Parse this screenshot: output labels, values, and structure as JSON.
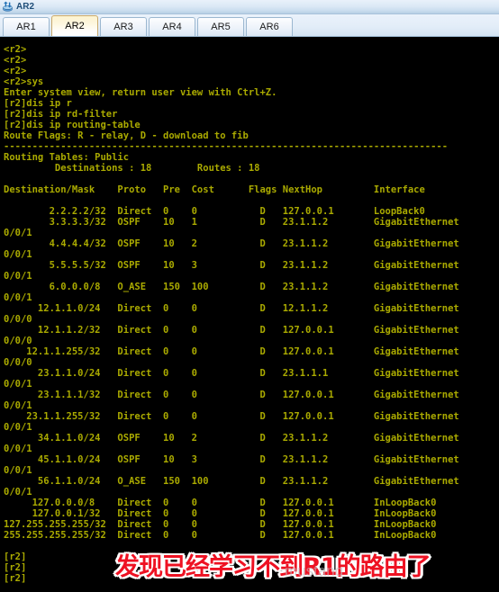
{
  "window": {
    "title": "AR2",
    "icon": "router-icon"
  },
  "tabs": [
    {
      "label": "AR1",
      "active": false
    },
    {
      "label": "AR2",
      "active": true
    },
    {
      "label": "AR3",
      "active": false
    },
    {
      "label": "AR4",
      "active": false
    },
    {
      "label": "AR5",
      "active": false
    },
    {
      "label": "AR6",
      "active": false
    }
  ],
  "terminal": {
    "prompt_user": "<r2>",
    "prompt_system": "[r2]",
    "foreground_color": "#aaaa00",
    "background_color": "#000000",
    "lines": [
      "<r2>",
      "<r2>",
      "<r2>",
      "<r2>sys",
      "Enter system view, return user view with Ctrl+Z.",
      "[r2]dis ip r",
      "[r2]dis ip rd-filter",
      "[r2]dis ip routing-table",
      "Route Flags: R - relay, D - download to fib",
      "------------------------------------------------------------------------------",
      "Routing Tables: Public",
      "         Destinations : 18        Routes : 18",
      "",
      "Destination/Mask    Proto   Pre  Cost      Flags NextHop         Interface",
      "",
      "        2.2.2.2/32  Direct  0    0           D   127.0.0.1       LoopBack0",
      "        3.3.3.3/32  OSPF    10   1           D   23.1.1.2        GigabitEthernet",
      "0/0/1",
      "        4.4.4.4/32  OSPF    10   2           D   23.1.1.2        GigabitEthernet",
      "0/0/1",
      "        5.5.5.5/32  OSPF    10   3           D   23.1.1.2        GigabitEthernet",
      "0/0/1",
      "        6.0.0.0/8   O_ASE   150  100         D   23.1.1.2        GigabitEthernet",
      "0/0/1",
      "      12.1.1.0/24   Direct  0    0           D   12.1.1.2        GigabitEthernet",
      "0/0/0",
      "      12.1.1.2/32   Direct  0    0           D   127.0.0.1       GigabitEthernet",
      "0/0/0",
      "    12.1.1.255/32   Direct  0    0           D   127.0.0.1       GigabitEthernet",
      "0/0/0",
      "      23.1.1.0/24   Direct  0    0           D   23.1.1.1        GigabitEthernet",
      "0/0/1",
      "      23.1.1.1/32   Direct  0    0           D   127.0.0.1       GigabitEthernet",
      "0/0/1",
      "    23.1.1.255/32   Direct  0    0           D   127.0.0.1       GigabitEthernet",
      "0/0/1",
      "      34.1.1.0/24   OSPF    10   2           D   23.1.1.2        GigabitEthernet",
      "0/0/1",
      "      45.1.1.0/24   OSPF    10   3           D   23.1.1.2        GigabitEthernet",
      "0/0/1",
      "      56.1.1.0/24   O_ASE   150  100         D   23.1.1.2        GigabitEthernet",
      "0/0/1",
      "     127.0.0.0/8    Direct  0    0           D   127.0.0.1       InLoopBack0",
      "     127.0.0.1/32   Direct  0    0           D   127.0.0.1       InLoopBack0",
      "127.255.255.255/32  Direct  0    0           D   127.0.0.1       InLoopBack0",
      "255.255.255.255/32  Direct  0    0           D   127.0.0.1       InLoopBack0",
      "",
      "[r2]",
      "[r2]",
      "[r2]"
    ],
    "routing_table": {
      "route_flags": "R - relay, D - download to fib",
      "table_name": "Public",
      "destinations": "18",
      "routes": "18",
      "columns": [
        "Destination/Mask",
        "Proto",
        "Pre",
        "Cost",
        "Flags",
        "NextHop",
        "Interface"
      ],
      "rows": [
        {
          "destination": "2.2.2.2/32",
          "proto": "Direct",
          "pre": "0",
          "cost": "0",
          "flags": "D",
          "nexthop": "127.0.0.1",
          "interface": "LoopBack0"
        },
        {
          "destination": "3.3.3.3/32",
          "proto": "OSPF",
          "pre": "10",
          "cost": "1",
          "flags": "D",
          "nexthop": "23.1.1.2",
          "interface": "GigabitEthernet0/0/1"
        },
        {
          "destination": "4.4.4.4/32",
          "proto": "OSPF",
          "pre": "10",
          "cost": "2",
          "flags": "D",
          "nexthop": "23.1.1.2",
          "interface": "GigabitEthernet0/0/1"
        },
        {
          "destination": "5.5.5.5/32",
          "proto": "OSPF",
          "pre": "10",
          "cost": "3",
          "flags": "D",
          "nexthop": "23.1.1.2",
          "interface": "GigabitEthernet0/0/1"
        },
        {
          "destination": "6.0.0.0/8",
          "proto": "O_ASE",
          "pre": "150",
          "cost": "100",
          "flags": "D",
          "nexthop": "23.1.1.2",
          "interface": "GigabitEthernet0/0/1"
        },
        {
          "destination": "12.1.1.0/24",
          "proto": "Direct",
          "pre": "0",
          "cost": "0",
          "flags": "D",
          "nexthop": "12.1.1.2",
          "interface": "GigabitEthernet0/0/0"
        },
        {
          "destination": "12.1.1.2/32",
          "proto": "Direct",
          "pre": "0",
          "cost": "0",
          "flags": "D",
          "nexthop": "127.0.0.1",
          "interface": "GigabitEthernet0/0/0"
        },
        {
          "destination": "12.1.1.255/32",
          "proto": "Direct",
          "pre": "0",
          "cost": "0",
          "flags": "D",
          "nexthop": "127.0.0.1",
          "interface": "GigabitEthernet0/0/0"
        },
        {
          "destination": "23.1.1.0/24",
          "proto": "Direct",
          "pre": "0",
          "cost": "0",
          "flags": "D",
          "nexthop": "23.1.1.1",
          "interface": "GigabitEthernet0/0/1"
        },
        {
          "destination": "23.1.1.1/32",
          "proto": "Direct",
          "pre": "0",
          "cost": "0",
          "flags": "D",
          "nexthop": "127.0.0.1",
          "interface": "GigabitEthernet0/0/1"
        },
        {
          "destination": "23.1.1.255/32",
          "proto": "Direct",
          "pre": "0",
          "cost": "0",
          "flags": "D",
          "nexthop": "127.0.0.1",
          "interface": "GigabitEthernet0/0/1"
        },
        {
          "destination": "34.1.1.0/24",
          "proto": "OSPF",
          "pre": "10",
          "cost": "2",
          "flags": "D",
          "nexthop": "23.1.1.2",
          "interface": "GigabitEthernet0/0/1"
        },
        {
          "destination": "45.1.1.0/24",
          "proto": "OSPF",
          "pre": "10",
          "cost": "3",
          "flags": "D",
          "nexthop": "23.1.1.2",
          "interface": "GigabitEthernet0/0/1"
        },
        {
          "destination": "56.1.1.0/24",
          "proto": "O_ASE",
          "pre": "150",
          "cost": "100",
          "flags": "D",
          "nexthop": "23.1.1.2",
          "interface": "GigabitEthernet0/0/1"
        },
        {
          "destination": "127.0.0.0/8",
          "proto": "Direct",
          "pre": "0",
          "cost": "0",
          "flags": "D",
          "nexthop": "127.0.0.1",
          "interface": "InLoopBack0"
        },
        {
          "destination": "127.0.0.1/32",
          "proto": "Direct",
          "pre": "0",
          "cost": "0",
          "flags": "D",
          "nexthop": "127.0.0.1",
          "interface": "InLoopBack0"
        },
        {
          "destination": "127.255.255.255/32",
          "proto": "Direct",
          "pre": "0",
          "cost": "0",
          "flags": "D",
          "nexthop": "127.0.0.1",
          "interface": "InLoopBack0"
        },
        {
          "destination": "255.255.255.255/32",
          "proto": "Direct",
          "pre": "0",
          "cost": "0",
          "flags": "D",
          "nexthop": "127.0.0.1",
          "interface": "InLoopBack0"
        }
      ]
    }
  },
  "annotation": {
    "text": "发现已经学习不到R1的路由了",
    "color": "#ee1122",
    "outline_color": "#ffffff"
  },
  "watermark": {
    "text": "mustang"
  }
}
